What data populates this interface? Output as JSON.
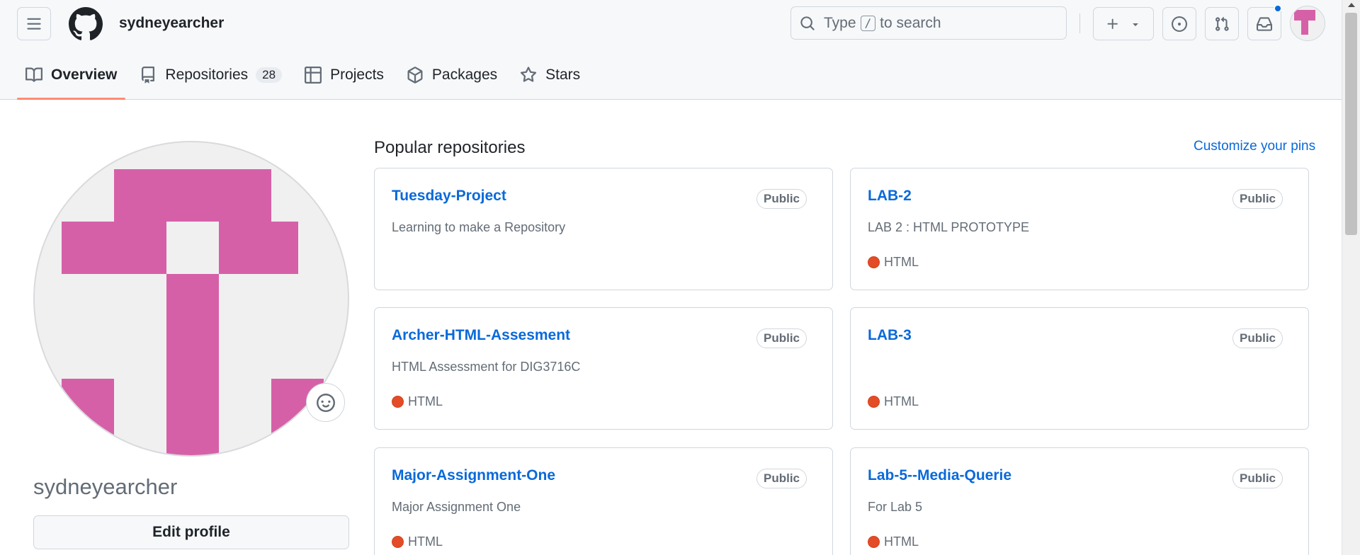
{
  "header": {
    "username": "sydneyearcher",
    "search": {
      "prefix": "Type",
      "key": "/",
      "suffix": "to search"
    }
  },
  "tabs": [
    {
      "label": "Overview",
      "icon": "book-icon",
      "active": true
    },
    {
      "label": "Repositories",
      "icon": "repo-icon",
      "count": "28"
    },
    {
      "label": "Projects",
      "icon": "table-icon"
    },
    {
      "label": "Packages",
      "icon": "package-icon"
    },
    {
      "label": "Stars",
      "icon": "star-icon"
    }
  ],
  "profile": {
    "name": "sydneyearcher",
    "edit_label": "Edit profile",
    "avatar_color": "#d660a8"
  },
  "popular": {
    "title": "Popular repositories",
    "customize_label": "Customize your pins",
    "repos": [
      {
        "name": "Tuesday-Project",
        "visibility": "Public",
        "description": "Learning to make a Repository",
        "language": ""
      },
      {
        "name": "LAB-2",
        "visibility": "Public",
        "description": "LAB 2 : HTML PROTOTYPE",
        "language": "HTML"
      },
      {
        "name": "Archer-HTML-Assesment",
        "visibility": "Public",
        "description": "HTML Assessment for DIG3716C",
        "language": "HTML"
      },
      {
        "name": "LAB-3",
        "visibility": "Public",
        "description": "",
        "language": "HTML"
      },
      {
        "name": "Major-Assignment-One",
        "visibility": "Public",
        "description": "Major Assignment One",
        "language": "HTML"
      },
      {
        "name": "Lab-5--Media-Querie",
        "visibility": "Public",
        "description": "For Lab 5",
        "language": "HTML"
      }
    ]
  },
  "colors": {
    "accent": "#0969da",
    "html_lang": "#e34c26",
    "tab_underline": "#fd8c73"
  }
}
